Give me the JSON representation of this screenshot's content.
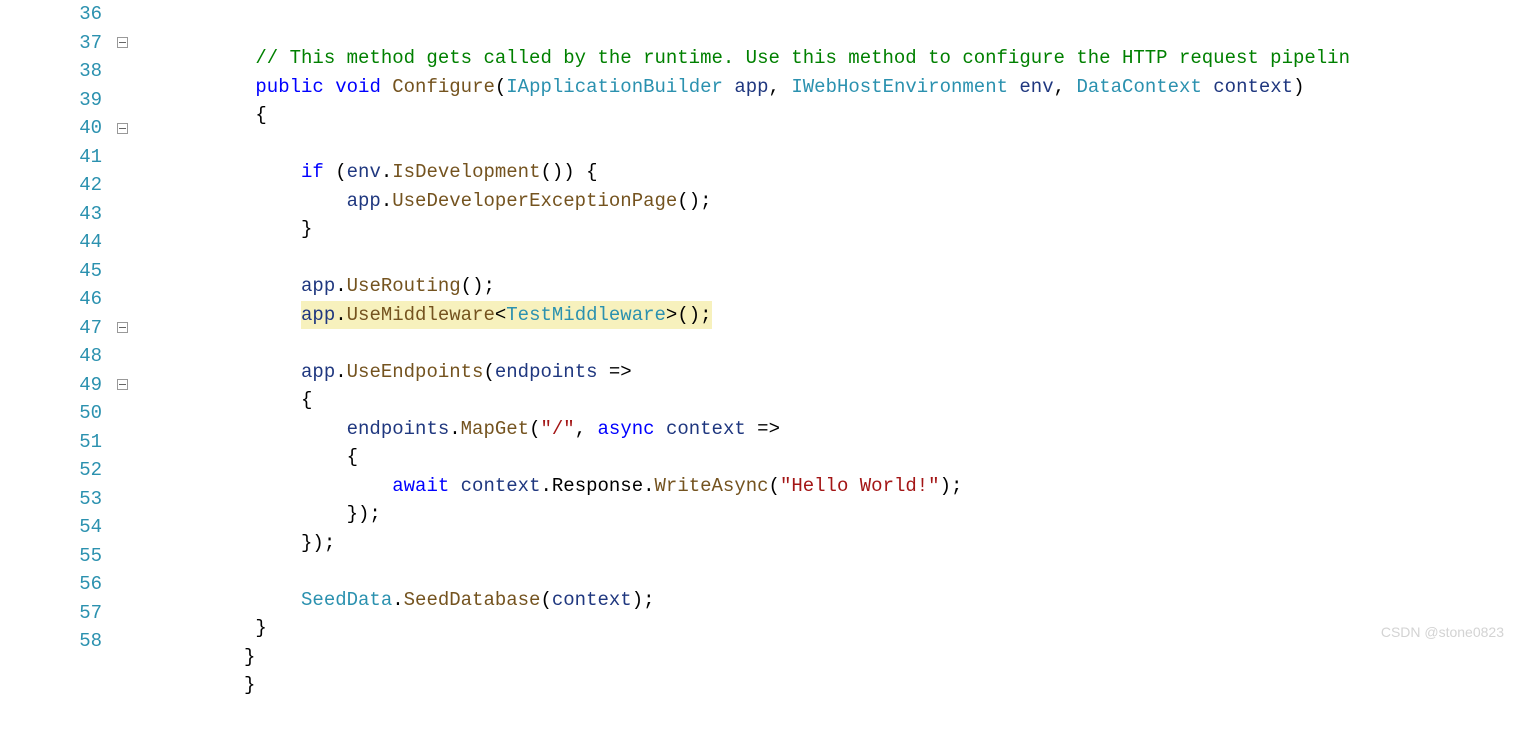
{
  "watermark": "CSDN @stone0823",
  "lineNumbers": [
    "36",
    "37",
    "38",
    "39",
    "40",
    "41",
    "42",
    "43",
    "44",
    "45",
    "46",
    "47",
    "48",
    "49",
    "50",
    "51",
    "52",
    "53",
    "54",
    "55",
    "56",
    "57",
    "58"
  ],
  "foldMarkers": {
    "37": true,
    "40": true,
    "47": true,
    "49": true
  },
  "code": {
    "l36_comment": "// This method gets called by the runtime. Use this method to configure the HTTP request pipelin",
    "l37": {
      "kw1": "public",
      "kw2": "void",
      "method": "Configure",
      "type1": "IApplicationBuilder",
      "p1": "app",
      "type2": "IWebHostEnvironment",
      "p2": "env",
      "type3": "DataContext",
      "p3": "context"
    },
    "l38": "{",
    "l40": {
      "kw": "if",
      "p": "env",
      "method": "IsDevelopment"
    },
    "l41": {
      "p": "app",
      "method": "UseDeveloperExceptionPage"
    },
    "l42": "}",
    "l44": {
      "p": "app",
      "method": "UseRouting"
    },
    "l45": {
      "p": "app",
      "method": "UseMiddleware",
      "type": "TestMiddleware"
    },
    "l47": {
      "p": "app",
      "method": "UseEndpoints",
      "param": "endpoints"
    },
    "l48": "{",
    "l49": {
      "p": "endpoints",
      "method": "MapGet",
      "str": "\"/\"",
      "kw": "async",
      "param": "context"
    },
    "l50": "{",
    "l51": {
      "kw": "await",
      "p": "context",
      "prop": "Response",
      "method": "WriteAsync",
      "str": "\"Hello World!\""
    },
    "l52": "});",
    "l53": "});",
    "l55": {
      "type": "SeedData",
      "method": "SeedDatabase",
      "p": "context"
    },
    "l56": "}",
    "l57": "}",
    "l58": "}"
  }
}
